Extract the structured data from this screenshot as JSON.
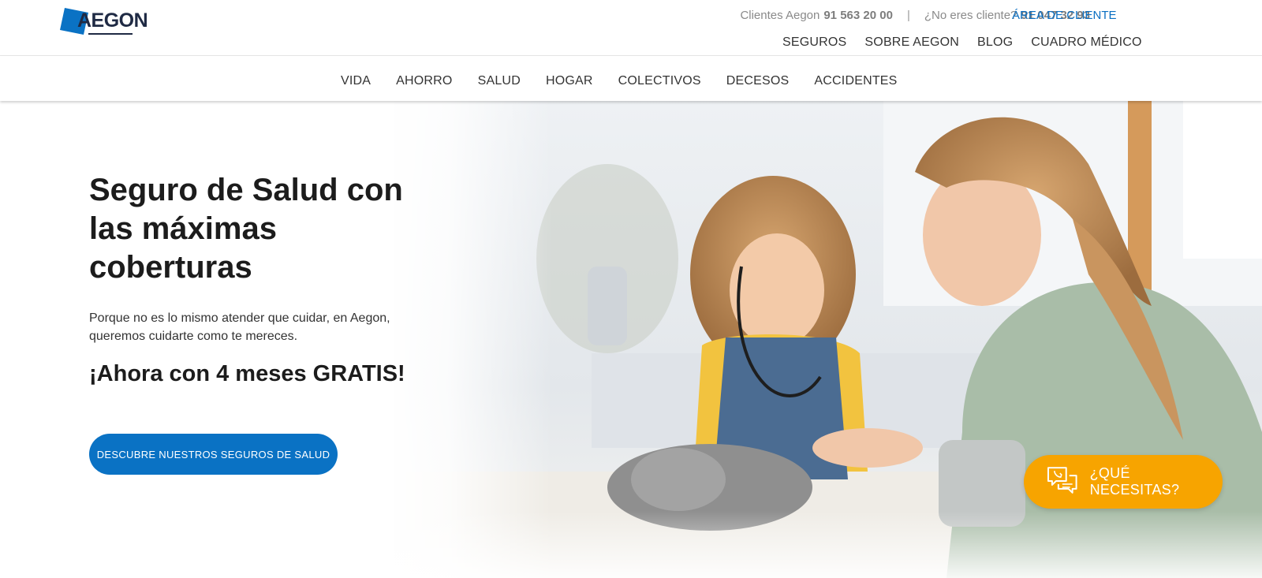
{
  "header": {
    "logo_text": "AEGON",
    "clients_label": "Clientes Aegon",
    "clients_phone": "91 563 20 00",
    "separator": "|",
    "non_clients_label": "¿No eres cliente?",
    "non_clients_phone": "91 047 32 93",
    "area_cliente": "ÁREA DE CLIENTE"
  },
  "secondary_nav": [
    "SEGUROS",
    "SOBRE AEGON",
    "BLOG",
    "CUADRO MÉDICO"
  ],
  "main_nav": [
    "VIDA",
    "AHORRO",
    "SALUD",
    "HOGAR",
    "COLECTIVOS",
    "DECESOS",
    "ACCIDENTES"
  ],
  "hero": {
    "title": "Seguro de Salud con las máximas coberturas",
    "subtitle": "Porque no es lo mismo atender que cuidar, en Aegon, queremos cuidarte como te mereces.",
    "promo": "¡Ahora con 4 meses GRATIS!",
    "cta": "DESCUBRE NUESTROS SEGUROS DE SALUD"
  },
  "help_button": {
    "label": "¿QUÉ NECESITAS?",
    "icon": "chat-bubbles-icon"
  },
  "colors": {
    "brand_blue": "#0a72c4",
    "accent_orange": "#f7a400",
    "logo_dark": "#1f2a44"
  }
}
